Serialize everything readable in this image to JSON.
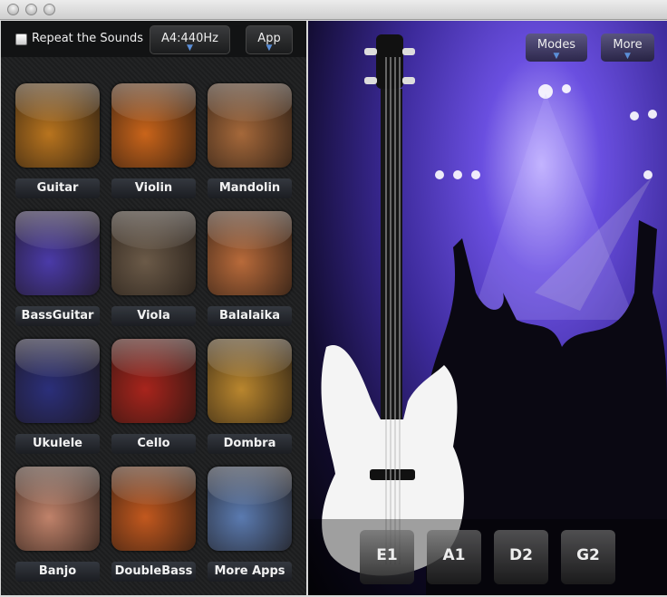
{
  "window": {
    "controls": [
      "close",
      "minimize",
      "zoom"
    ]
  },
  "left_panel": {
    "repeat_label": "Repeat the Sounds",
    "repeat_checked": false,
    "pitch_button": "A4:440Hz",
    "app_button": "App",
    "instruments": [
      {
        "label": "Guitar",
        "color": "#b8741e"
      },
      {
        "label": "Violin",
        "color": "#c9641a"
      },
      {
        "label": "Mandolin",
        "color": "#a5683a"
      },
      {
        "label": "BassGuitar",
        "color": "#4a3aa8"
      },
      {
        "label": "Viola",
        "color": "#6b5a48"
      },
      {
        "label": "Balalaika",
        "color": "#b86a3a"
      },
      {
        "label": "Ukulele",
        "color": "#2b2f7a"
      },
      {
        "label": "Cello",
        "color": "#a8241c"
      },
      {
        "label": "Dombra",
        "color": "#b9862e"
      },
      {
        "label": "Banjo",
        "color": "#c0826a"
      },
      {
        "label": "DoubleBass",
        "color": "#c2581e"
      },
      {
        "label": "More Apps",
        "color": "#5a7ab0"
      }
    ]
  },
  "right_panel": {
    "modes_button": "Modes",
    "more_button": "More",
    "strings": [
      "E1",
      "A1",
      "D2",
      "G2"
    ],
    "accent": "#6a4fe0"
  }
}
